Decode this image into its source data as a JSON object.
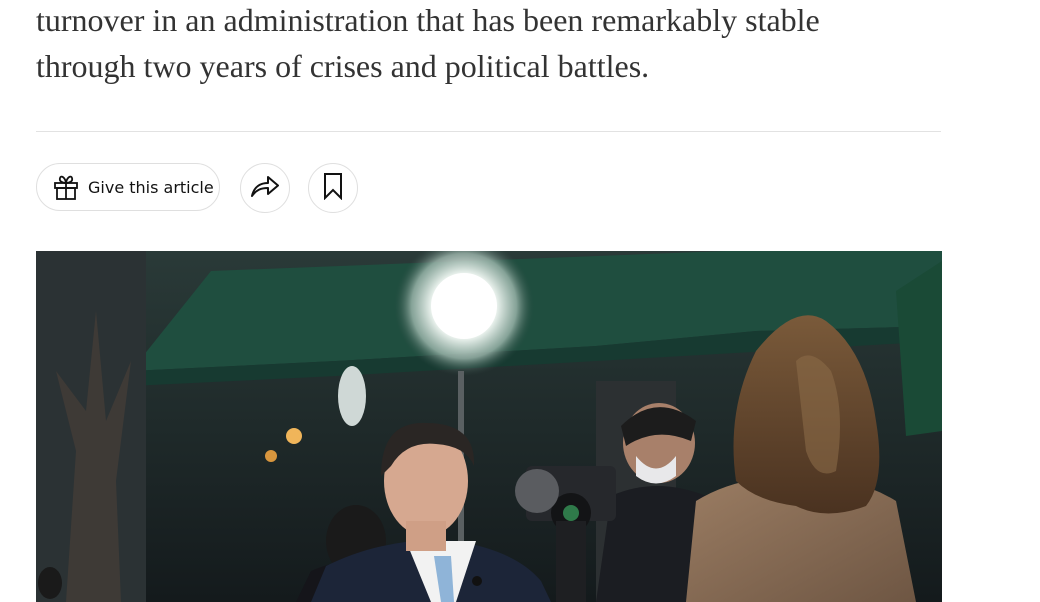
{
  "article": {
    "summary_lines": [
      "turnover in an administration that has been remarkably stable",
      "through two years of crises and political battles."
    ]
  },
  "share_tools": {
    "gift_label": "Give this article",
    "gift_icon": "gift-icon",
    "share_icon": "share-arrow-icon",
    "save_icon": "bookmark-icon"
  },
  "photo": {
    "alt": "A man in a suit being interviewed outdoors by a reporter with camera crews and lights behind him"
  }
}
